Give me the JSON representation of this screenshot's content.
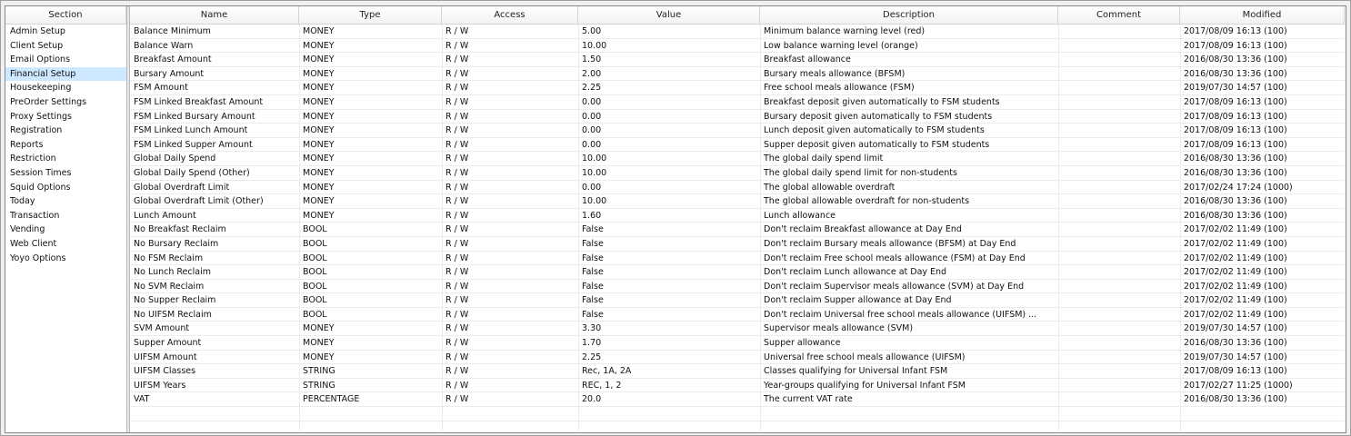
{
  "headers": {
    "section": "Section",
    "name": "Name",
    "type": "Type",
    "access": "Access",
    "value": "Value",
    "description": "Description",
    "comment": "Comment",
    "modified": "Modified"
  },
  "sections": [
    {
      "label": "Admin Setup",
      "selected": false
    },
    {
      "label": "Client Setup",
      "selected": false
    },
    {
      "label": "Email Options",
      "selected": false
    },
    {
      "label": "Financial Setup",
      "selected": true
    },
    {
      "label": "Housekeeping",
      "selected": false
    },
    {
      "label": "PreOrder Settings",
      "selected": false
    },
    {
      "label": "Proxy Settings",
      "selected": false
    },
    {
      "label": "Registration",
      "selected": false
    },
    {
      "label": "Reports",
      "selected": false
    },
    {
      "label": "Restriction",
      "selected": false
    },
    {
      "label": "Session Times",
      "selected": false
    },
    {
      "label": "Squid Options",
      "selected": false
    },
    {
      "label": "Today",
      "selected": false
    },
    {
      "label": "Transaction",
      "selected": false
    },
    {
      "label": "Vending",
      "selected": false
    },
    {
      "label": "Web Client",
      "selected": false
    },
    {
      "label": "Yoyo Options",
      "selected": false
    }
  ],
  "rows": [
    {
      "name": "Balance Minimum",
      "type": "MONEY",
      "access": "R / W",
      "value": "5.00",
      "description": "Minimum balance warning level (red)",
      "comment": "",
      "modified": "2017/08/09 16:13 (100)"
    },
    {
      "name": "Balance Warn",
      "type": "MONEY",
      "access": "R / W",
      "value": "10.00",
      "description": "Low balance warning level (orange)",
      "comment": "",
      "modified": "2017/08/09 16:13 (100)"
    },
    {
      "name": "Breakfast Amount",
      "type": "MONEY",
      "access": "R / W",
      "value": "1.50",
      "description": "Breakfast allowance",
      "comment": "",
      "modified": "2016/08/30 13:36 (100)"
    },
    {
      "name": "Bursary Amount",
      "type": "MONEY",
      "access": "R / W",
      "value": "2.00",
      "description": "Bursary meals allowance (BFSM)",
      "comment": "",
      "modified": "2016/08/30 13:36 (100)"
    },
    {
      "name": "FSM Amount",
      "type": "MONEY",
      "access": "R / W",
      "value": "2.25",
      "description": "Free school meals allowance (FSM)",
      "comment": "",
      "modified": "2019/07/30 14:57 (100)"
    },
    {
      "name": "FSM Linked Breakfast Amount",
      "type": "MONEY",
      "access": "R / W",
      "value": "0.00",
      "description": "Breakfast deposit given automatically to FSM students",
      "comment": "",
      "modified": "2017/08/09 16:13 (100)"
    },
    {
      "name": "FSM Linked Bursary Amount",
      "type": "MONEY",
      "access": "R / W",
      "value": "0.00",
      "description": "Bursary deposit given automatically to FSM students",
      "comment": "",
      "modified": "2017/08/09 16:13 (100)"
    },
    {
      "name": "FSM Linked Lunch Amount",
      "type": "MONEY",
      "access": "R / W",
      "value": "0.00",
      "description": "Lunch deposit given automatically to FSM students",
      "comment": "",
      "modified": "2017/08/09 16:13 (100)"
    },
    {
      "name": "FSM Linked Supper Amount",
      "type": "MONEY",
      "access": "R / W",
      "value": "0.00",
      "description": "Supper deposit given automatically to FSM students",
      "comment": "",
      "modified": "2017/08/09 16:13 (100)"
    },
    {
      "name": "Global Daily Spend",
      "type": "MONEY",
      "access": "R / W",
      "value": "10.00",
      "description": "The global daily spend limit",
      "comment": "",
      "modified": "2016/08/30 13:36 (100)"
    },
    {
      "name": "Global Daily Spend (Other)",
      "type": "MONEY",
      "access": "R / W",
      "value": "10.00",
      "description": "The global daily spend limit for non-students",
      "comment": "",
      "modified": "2016/08/30 13:36 (100)"
    },
    {
      "name": "Global Overdraft Limit",
      "type": "MONEY",
      "access": "R / W",
      "value": "0.00",
      "description": "The global allowable overdraft",
      "comment": "",
      "modified": "2017/02/24 17:24 (1000)"
    },
    {
      "name": "Global Overdraft Limit (Other)",
      "type": "MONEY",
      "access": "R / W",
      "value": "10.00",
      "description": "The global allowable overdraft for non-students",
      "comment": "",
      "modified": "2016/08/30 13:36 (100)"
    },
    {
      "name": "Lunch Amount",
      "type": "MONEY",
      "access": "R / W",
      "value": "1.60",
      "description": "Lunch allowance",
      "comment": "",
      "modified": "2016/08/30 13:36 (100)"
    },
    {
      "name": "No Breakfast Reclaim",
      "type": "BOOL",
      "access": "R / W",
      "value": "False",
      "description": "Don't reclaim Breakfast allowance at Day End",
      "comment": "",
      "modified": "2017/02/02 11:49 (100)"
    },
    {
      "name": "No Bursary Reclaim",
      "type": "BOOL",
      "access": "R / W",
      "value": "False",
      "description": "Don't reclaim Bursary meals allowance (BFSM) at Day End",
      "comment": "",
      "modified": "2017/02/02 11:49 (100)"
    },
    {
      "name": "No FSM Reclaim",
      "type": "BOOL",
      "access": "R / W",
      "value": "False",
      "description": "Don't reclaim Free school meals allowance (FSM) at Day End",
      "comment": "",
      "modified": "2017/02/02 11:49 (100)"
    },
    {
      "name": "No Lunch Reclaim",
      "type": "BOOL",
      "access": "R / W",
      "value": "False",
      "description": "Don't reclaim Lunch allowance at Day End",
      "comment": "",
      "modified": "2017/02/02 11:49 (100)"
    },
    {
      "name": "No SVM Reclaim",
      "type": "BOOL",
      "access": "R / W",
      "value": "False",
      "description": "Don't reclaim Supervisor meals allowance (SVM) at Day End",
      "comment": "",
      "modified": "2017/02/02 11:49 (100)"
    },
    {
      "name": "No Supper Reclaim",
      "type": "BOOL",
      "access": "R / W",
      "value": "False",
      "description": "Don't reclaim Supper allowance at Day End",
      "comment": "",
      "modified": "2017/02/02 11:49 (100)"
    },
    {
      "name": "No UIFSM Reclaim",
      "type": "BOOL",
      "access": "R / W",
      "value": "False",
      "description": "Don't reclaim Universal free school meals allowance (UIFSM) ...",
      "comment": "",
      "modified": "2017/02/02 11:49 (100)"
    },
    {
      "name": "SVM Amount",
      "type": "MONEY",
      "access": "R / W",
      "value": "3.30",
      "description": "Supervisor meals allowance (SVM)",
      "comment": "",
      "modified": "2019/07/30 14:57 (100)"
    },
    {
      "name": "Supper Amount",
      "type": "MONEY",
      "access": "R / W",
      "value": "1.70",
      "description": "Supper allowance",
      "comment": "",
      "modified": "2016/08/30 13:36 (100)"
    },
    {
      "name": "UIFSM Amount",
      "type": "MONEY",
      "access": "R / W",
      "value": "2.25",
      "description": "Universal free school meals allowance (UIFSM)",
      "comment": "",
      "modified": "2019/07/30 14:57 (100)"
    },
    {
      "name": "UIFSM Classes",
      "type": "STRING",
      "access": "R / W",
      "value": "Rec, 1A, 2A",
      "description": "Classes qualifying for Universal Infant FSM",
      "comment": "",
      "modified": "2017/08/09 16:13 (100)"
    },
    {
      "name": "UIFSM Years",
      "type": "STRING",
      "access": "R / W",
      "value": "REC, 1, 2",
      "description": "Year-groups qualifying for Universal Infant FSM",
      "comment": "",
      "modified": "2017/02/27 11:25 (1000)"
    },
    {
      "name": "VAT",
      "type": "PERCENTAGE",
      "access": "R / W",
      "value": "20.0",
      "description": "The current VAT rate",
      "comment": "",
      "modified": "2016/08/30 13:36 (100)"
    }
  ]
}
